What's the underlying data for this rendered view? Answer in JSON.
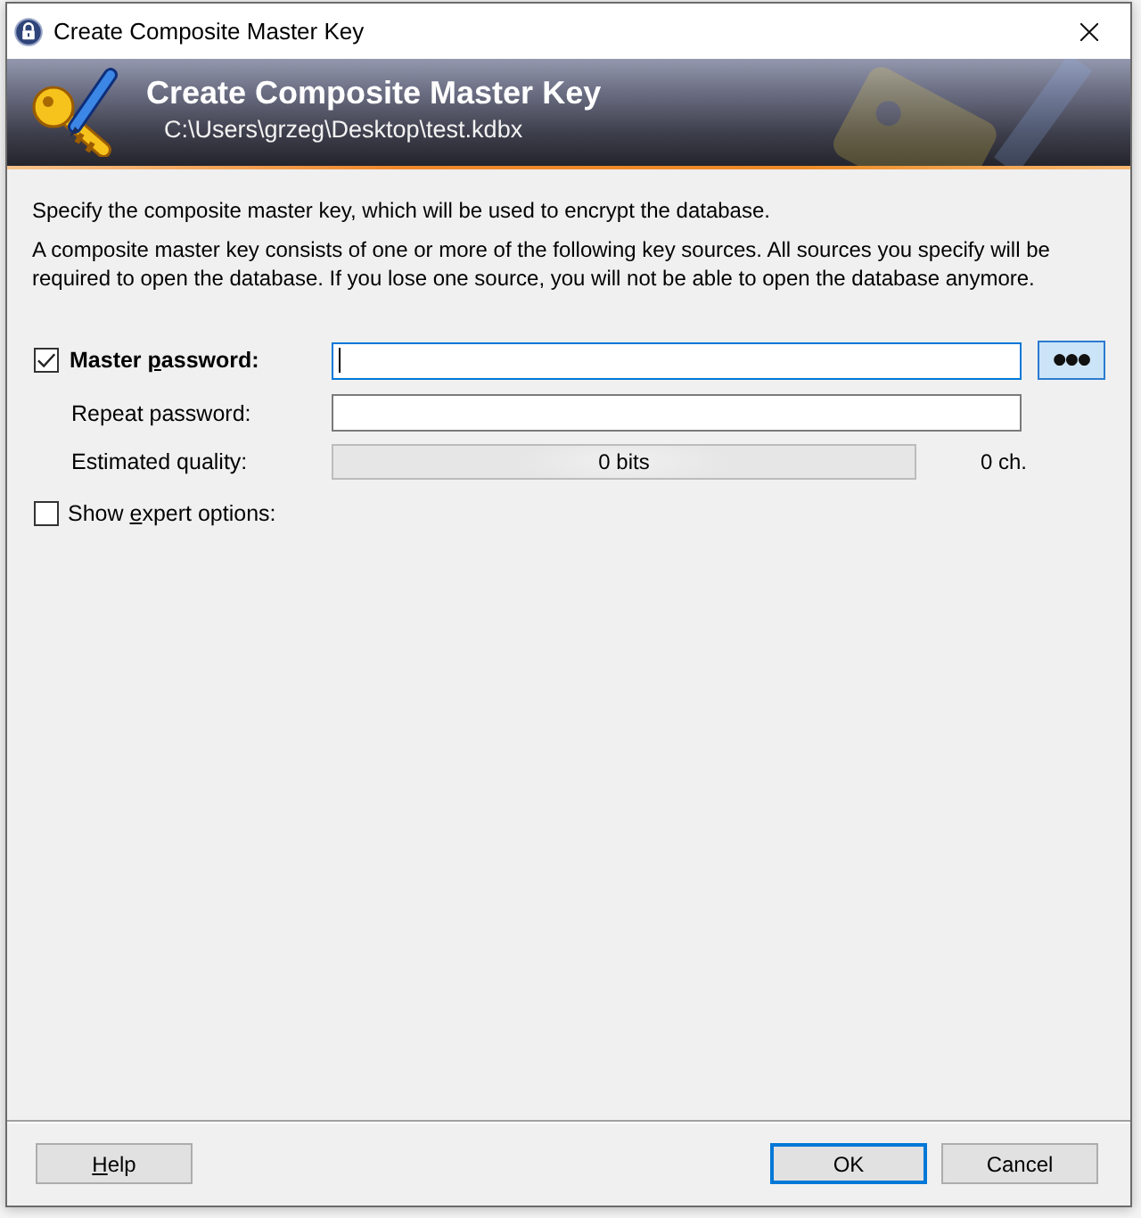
{
  "window": {
    "title": "Create Composite Master Key"
  },
  "banner": {
    "title": "Create Composite Master Key",
    "path": "C:\\Users\\grzeg\\Desktop\\test.kdbx"
  },
  "intro": "Specify the composite master key, which will be used to encrypt the database.",
  "description": "A composite master key consists of one or more of the following key sources. All sources you specify will be required to open the database. If you lose one source, you will not be able to open the database anymore.",
  "master_password": {
    "checked": true,
    "label": [
      {
        "kind": "text",
        "text": "Master "
      },
      {
        "kind": "access_key",
        "text": "p"
      },
      {
        "kind": "text",
        "text": "assword:"
      }
    ],
    "focused": true,
    "reveal_button": {
      "label": "●●●",
      "on": true
    }
  },
  "repeat_password": {
    "label": "Repeat password:"
  },
  "quality": {
    "label": "Estimated quality:",
    "reading": "0 bits",
    "length": "0 ch."
  },
  "expert_options": {
    "checked": false,
    "label": [
      {
        "kind": "text",
        "text": "Show "
      },
      {
        "kind": "access_key",
        "text": "e"
      },
      {
        "kind": "text",
        "text": "xpert options:"
      }
    ]
  },
  "buttons": [
    {
      "label": [
        {
          "kind": "access_key",
          "text": "H"
        },
        {
          "kind": "text",
          "text": "elp"
        }
      ],
      "default": false
    },
    {
      "label": [
        {
          "kind": "text",
          "text": "OK"
        }
      ],
      "default": true
    },
    {
      "label": [
        {
          "kind": "text",
          "text": "Cancel"
        }
      ],
      "default": false
    }
  ]
}
